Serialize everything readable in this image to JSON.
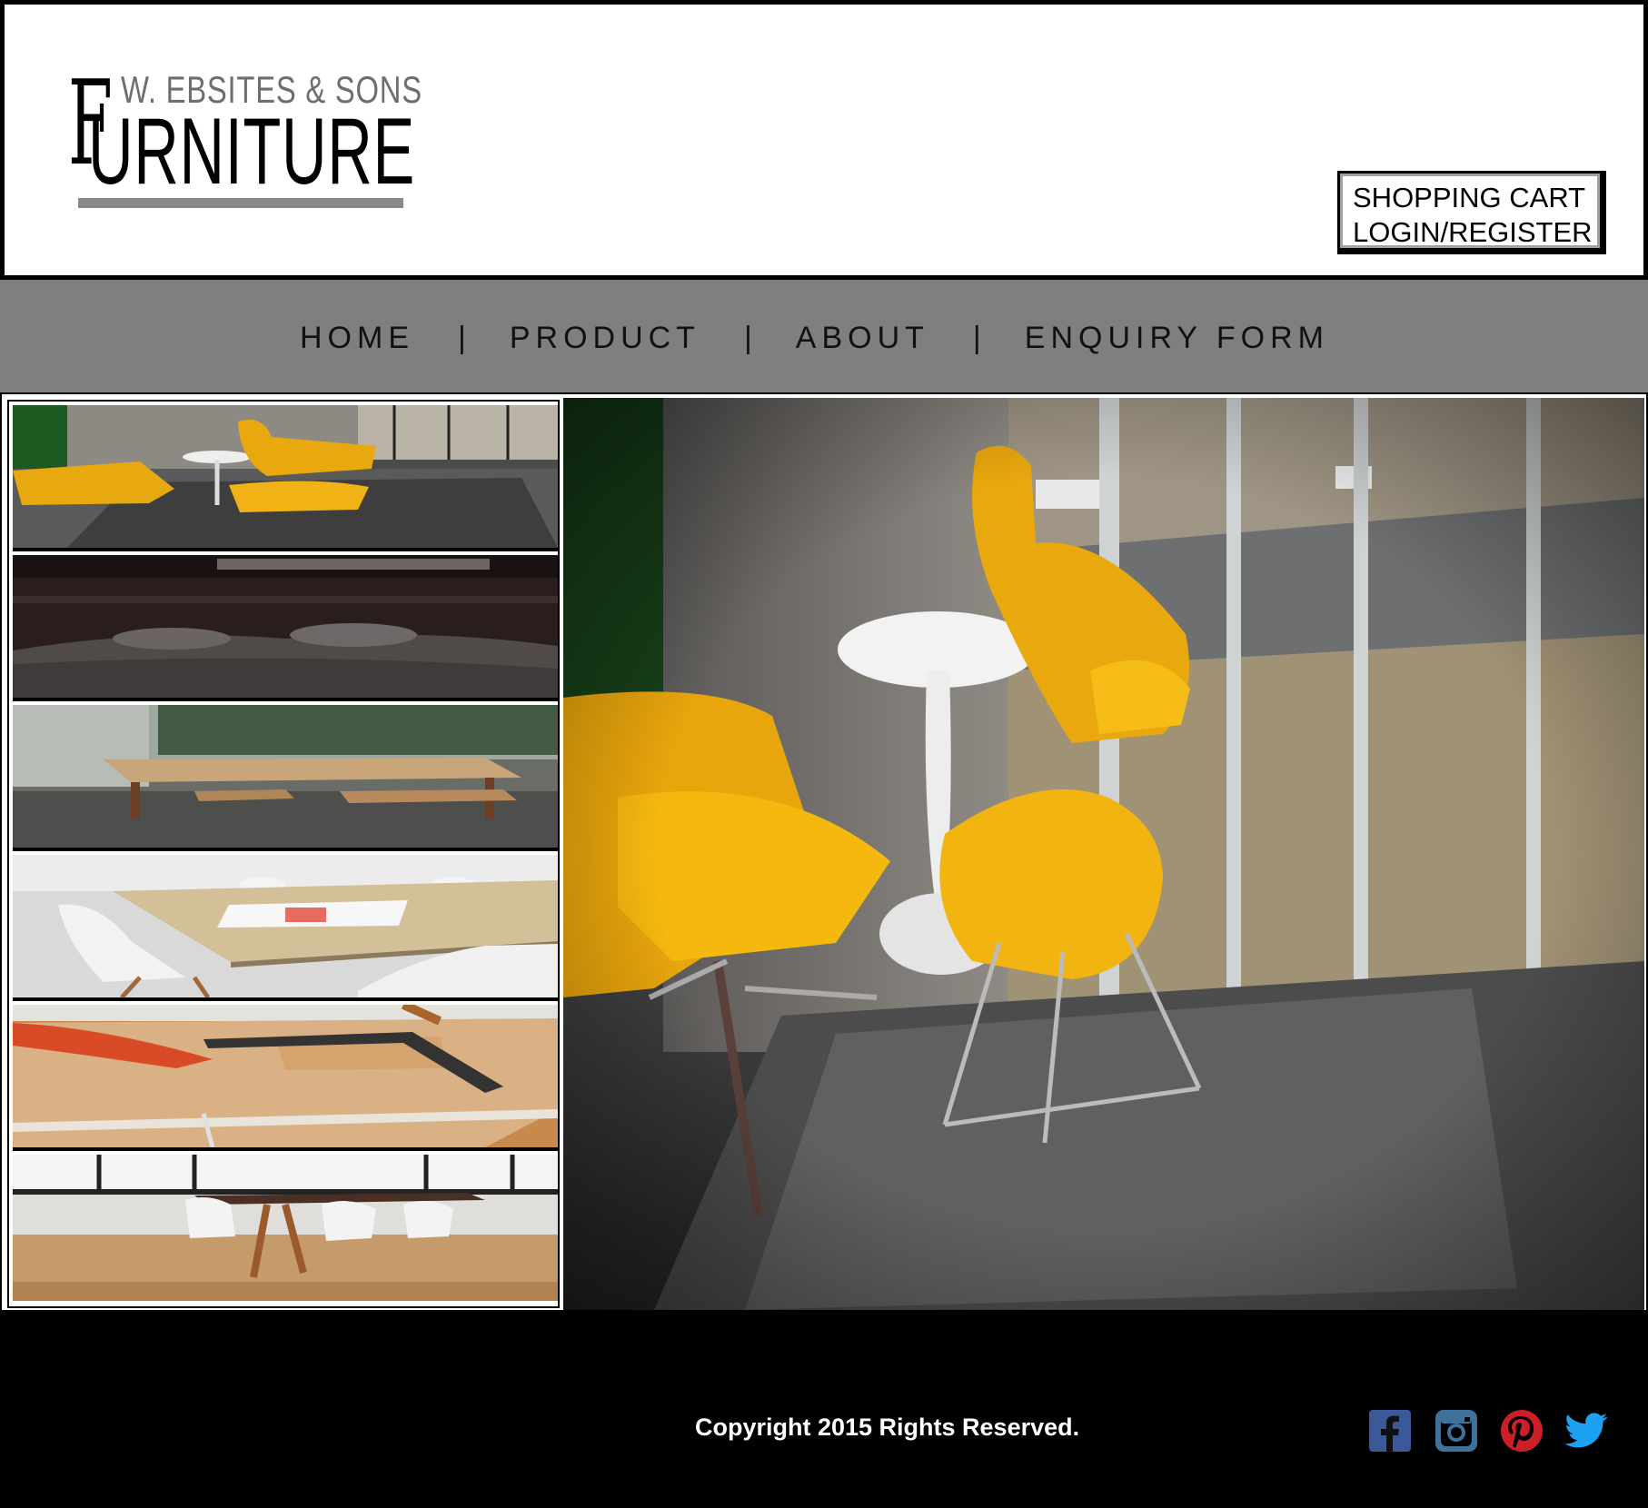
{
  "header": {
    "logo": {
      "top_line": "W. EBSITES & SONS",
      "main_word": "URNITURE",
      "initial": "F"
    },
    "account": {
      "cart_label": "SHOPPING CART",
      "login_label": "LOGIN/REGISTER"
    }
  },
  "nav": {
    "items": [
      {
        "label": "HOME"
      },
      {
        "label": "PRODUCT"
      },
      {
        "label": "ABOUT"
      },
      {
        "label": "ENQUIRY FORM"
      }
    ],
    "separator": "|"
  },
  "gallery": {
    "thumbnails": [
      {
        "icon": "yellow-lounge-chairs-photo"
      },
      {
        "icon": "bedroom-photo"
      },
      {
        "icon": "wooden-table-benches-photo"
      },
      {
        "icon": "white-chairs-table-photo"
      },
      {
        "icon": "workshop-table-photo"
      },
      {
        "icon": "dining-room-photo"
      }
    ],
    "hero": {
      "icon": "yellow-chairs-hero-photo"
    }
  },
  "footer": {
    "copyright": "Copyright 2015 Rights Reserved.",
    "social": [
      {
        "icon": "facebook-icon",
        "color": "#3b5998"
      },
      {
        "icon": "instagram-icon",
        "color": "#3f729b"
      },
      {
        "icon": "pinterest-icon",
        "color": "#cb2027"
      },
      {
        "icon": "twitter-icon",
        "color": "#1da1f2"
      }
    ]
  }
}
